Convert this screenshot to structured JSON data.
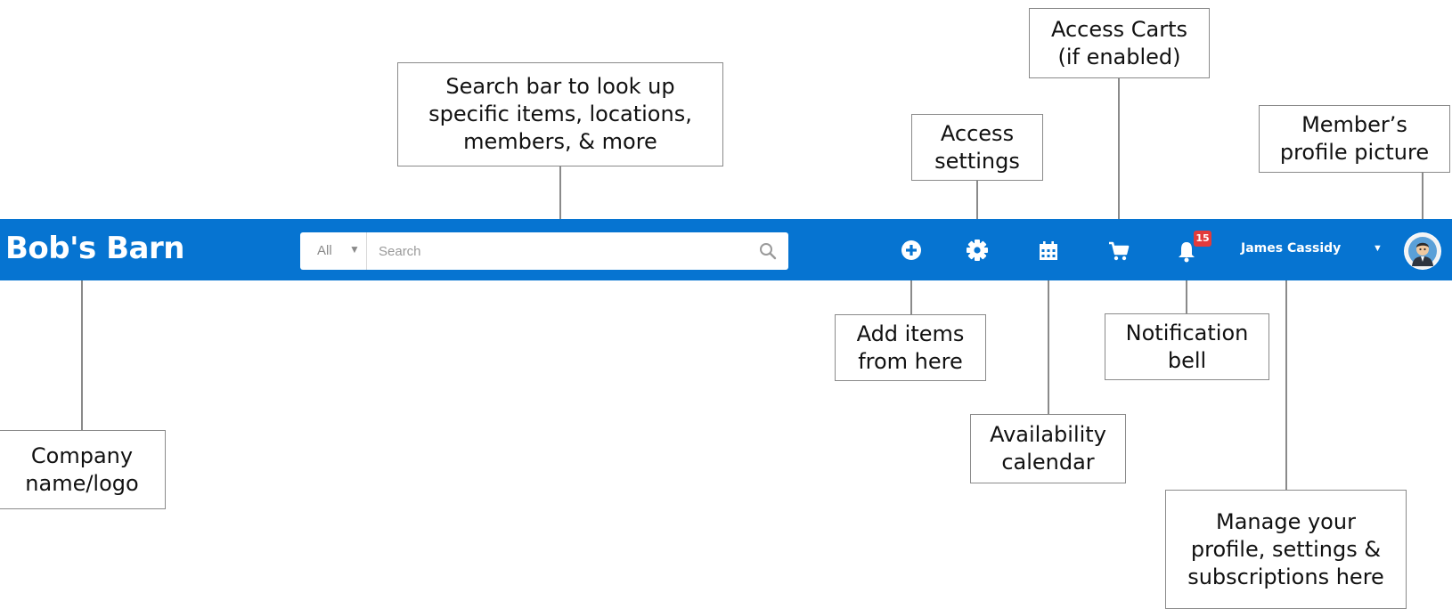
{
  "navbar": {
    "brand": "Bob's Barn",
    "search": {
      "scope": "All",
      "placeholder": "Search"
    },
    "icons": [
      "add-icon",
      "gear-icon",
      "calendar-icon",
      "cart-icon",
      "bell-icon"
    ],
    "notification_count": "15",
    "user_name": "James Cassidy",
    "colors": {
      "bar": "#0674d1",
      "badge": "#e23b3b"
    }
  },
  "callouts": {
    "search": "Search bar to look up\nspecific items, locations,\nmembers, & more",
    "settings": "Access\nsettings",
    "carts": "Access Carts\n(if enabled)",
    "profile_picture": "Member’s\nprofile picture",
    "company": "Company\nname/logo",
    "add_items": "Add items\nfrom here",
    "calendar": "Availability\ncalendar",
    "bell": "Notification\nbell",
    "manage": "Manage your\nprofile, settings &\nsubscriptions here"
  }
}
